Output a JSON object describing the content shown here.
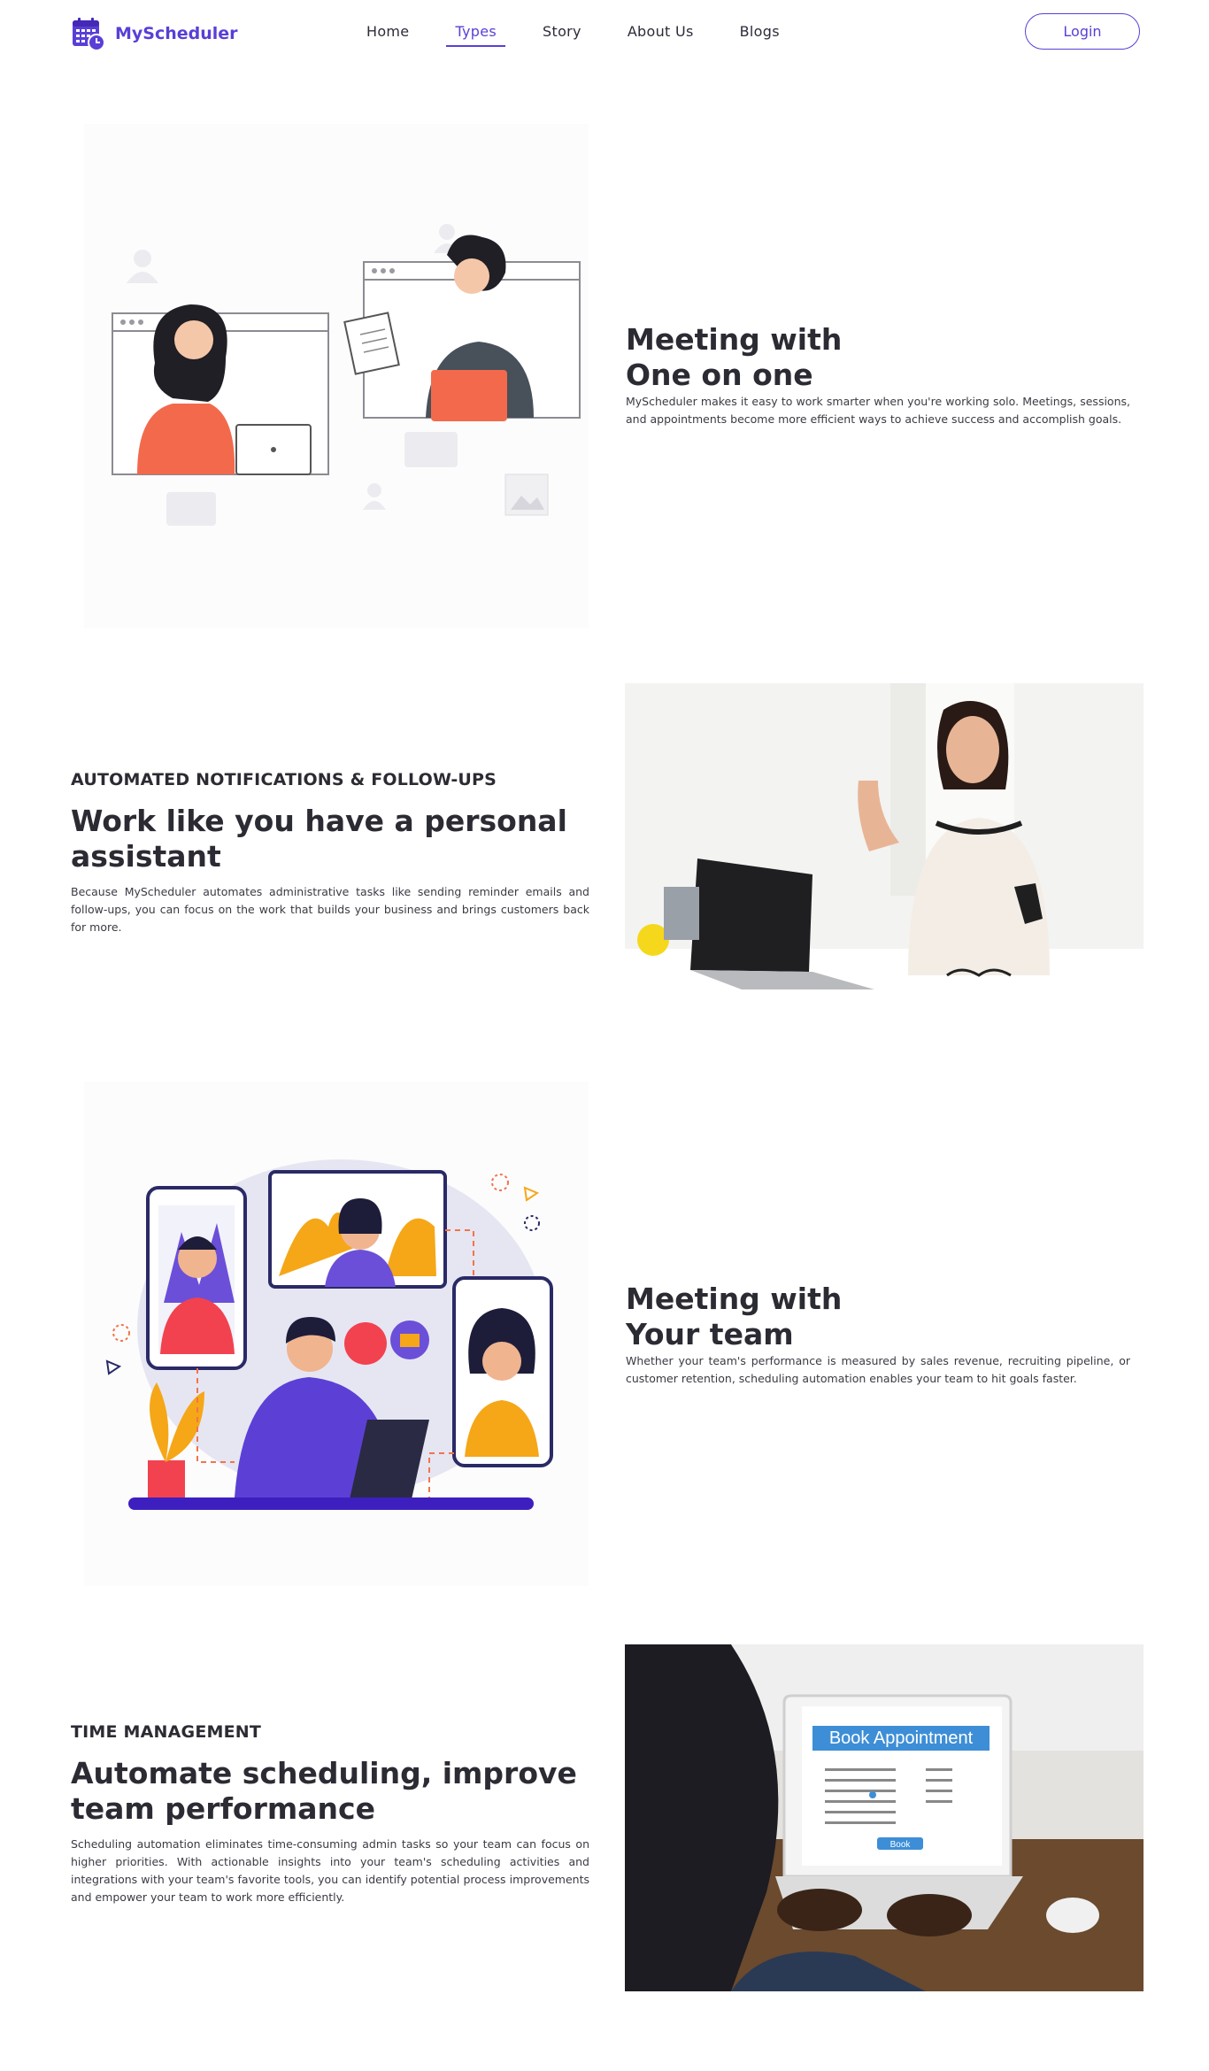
{
  "brand": {
    "name": "MyScheduler"
  },
  "nav": {
    "items": [
      {
        "label": "Home"
      },
      {
        "label": "Types"
      },
      {
        "label": "Story"
      },
      {
        "label": "About Us"
      },
      {
        "label": "Blogs"
      }
    ],
    "active": "Types",
    "login_label": "Login"
  },
  "sections": [
    {
      "title_line1": "Meeting with",
      "title_line2": "One on one",
      "description": "MyScheduler makes it easy to work smarter when you're working solo. Meetings, sessions, and appointments become more efficient ways to achieve success and accomplish goals."
    },
    {
      "kicker": "AUTOMATED NOTIFICATIONS & FOLLOW-UPS",
      "title": "Work like you have a personal assistant",
      "description": "Because MyScheduler automates administrative tasks like sending reminder emails and follow-ups, you can focus on the work that builds your business and brings customers back for more."
    },
    {
      "title_line1": "Meeting with",
      "title_line2": "Your team",
      "description": "Whether your team's performance is measured by sales revenue, recruiting pipeline, or customer retention, scheduling automation enables your team to hit goals faster."
    },
    {
      "kicker": "TIME MANAGEMENT",
      "title": "Automate scheduling, improve team performance",
      "description": "Scheduling automation eliminates time-consuming admin tasks so your team can focus on higher priorities. With actionable insights into your team's scheduling activities and integrations with your team's favorite tools, you can identify potential process improvements and empower your team to work more efficiently.",
      "screen_title": "Book Appointment",
      "screen_button": "Book"
    }
  ],
  "colors": {
    "accent": "#5a3fd6",
    "text": "#2b2b33"
  }
}
